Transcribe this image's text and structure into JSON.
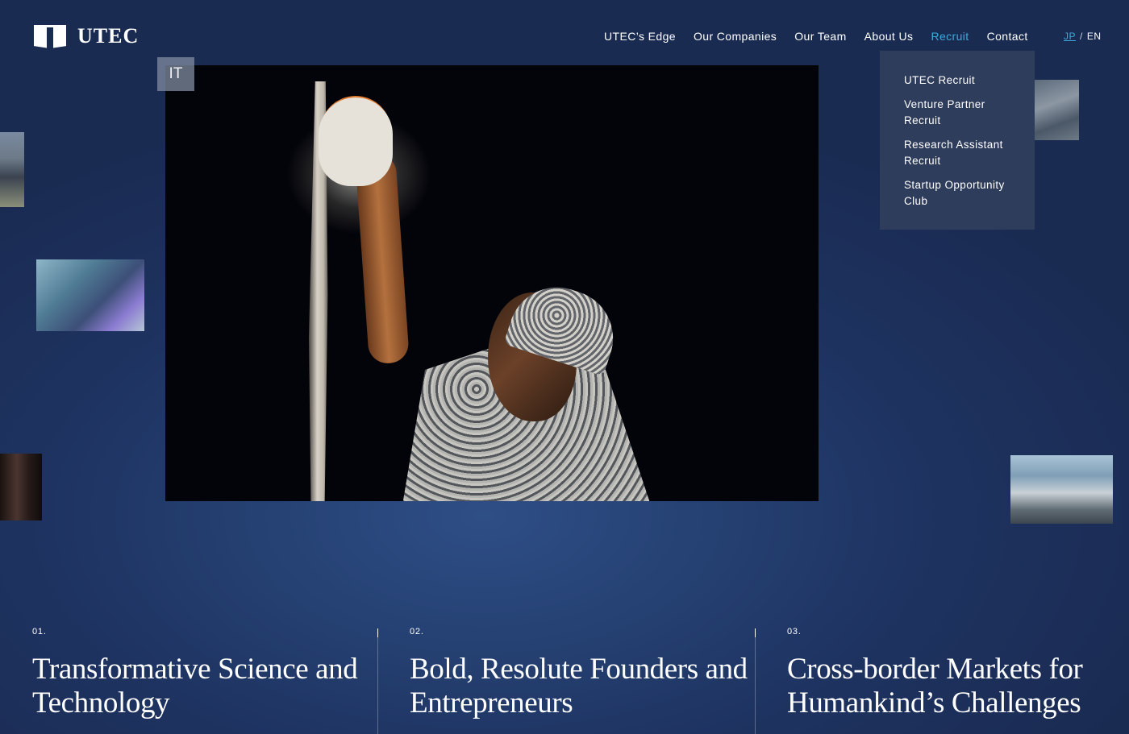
{
  "brand": {
    "name": "UTEC"
  },
  "nav": {
    "items": [
      {
        "label": "UTEC’s Edge"
      },
      {
        "label": "Our Companies"
      },
      {
        "label": "Our Team"
      },
      {
        "label": "About Us"
      },
      {
        "label": "Recruit",
        "active": true
      },
      {
        "label": "Contact"
      }
    ],
    "lang": {
      "jp": "JP",
      "separator": "/",
      "en": "EN"
    }
  },
  "recruit_menu": {
    "items": [
      {
        "label": "UTEC Recruit"
      },
      {
        "label": "Venture Partner Recruit"
      },
      {
        "label": "Research Assistant Recruit"
      },
      {
        "label": "Startup Opportunity Club"
      }
    ]
  },
  "hero": {
    "category_tag": "IT"
  },
  "pillars": [
    {
      "number": "01.",
      "title": "Transformative Science and Technology"
    },
    {
      "number": "02.",
      "title": "Bold, Resolute Founders and Entrepreneurs"
    },
    {
      "number": "03.",
      "title": "Cross-border Markets for Humankind’s Challenges"
    }
  ],
  "colors": {
    "accent": "#3fa9dc",
    "background": "#1e3361",
    "dropdown": "#2f3d5c"
  }
}
